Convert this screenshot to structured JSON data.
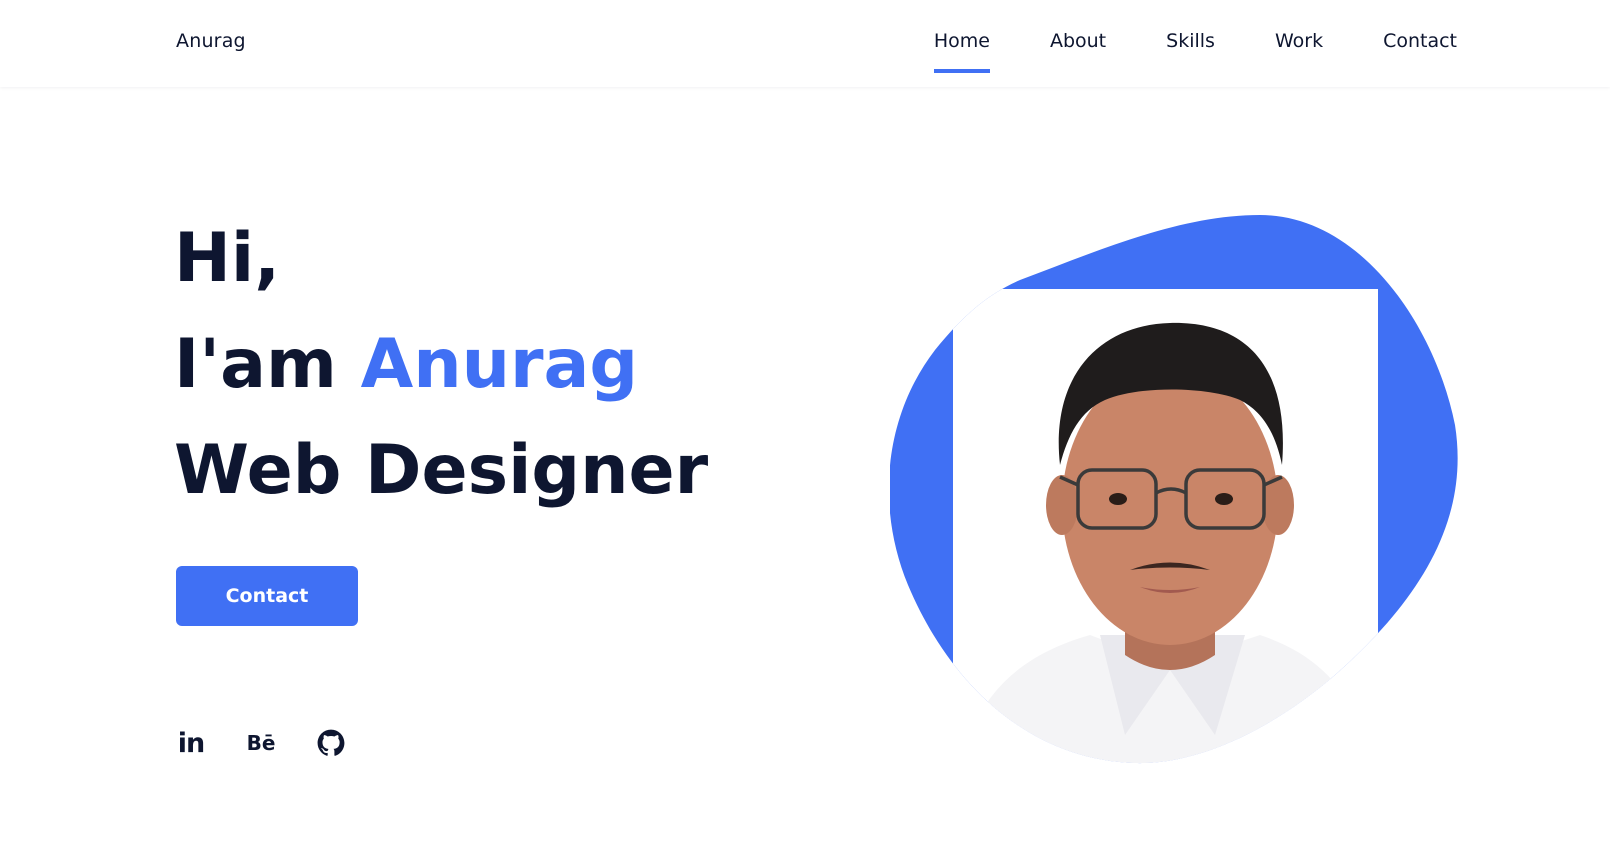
{
  "header": {
    "logo": "Anurag",
    "nav": [
      {
        "label": "Home",
        "active": true
      },
      {
        "label": "About",
        "active": false
      },
      {
        "label": "Skills",
        "active": false
      },
      {
        "label": "Work",
        "active": false
      },
      {
        "label": "Contact",
        "active": false
      }
    ]
  },
  "hero": {
    "greeting": "Hi,",
    "intro_prefix": "I'am",
    "name": "Anurag",
    "role": "Web Designer",
    "button_label": "Contact"
  },
  "social": [
    {
      "icon": "linkedin-icon",
      "label": "in"
    },
    {
      "icon": "behance-icon",
      "label": "Bē"
    },
    {
      "icon": "github-icon"
    }
  ],
  "colors": {
    "accent": "#4070f4",
    "text": "#0e1630",
    "background": "#ffffff"
  }
}
